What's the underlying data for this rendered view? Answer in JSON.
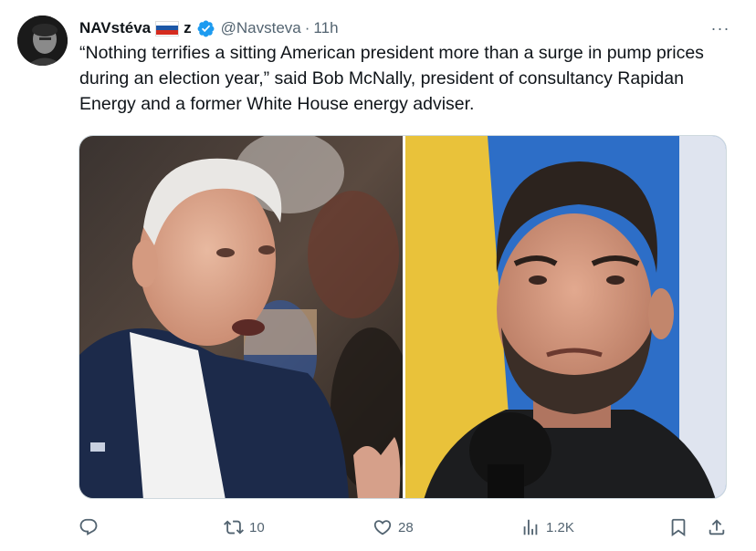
{
  "tweet": {
    "display_name_prefix": "NAVstéva",
    "display_name_suffix": "z",
    "handle": "@Navsteva",
    "separator": "·",
    "time": "11h",
    "more_label": "···",
    "text": "“Nothing terrifies a sitting American president more than a surge in pump prices during an election year,” said Bob McNally, president of consultancy Rapidan Energy and a former White House energy adviser."
  },
  "colors": {
    "verified": "#1d9bf0",
    "secondary_text": "#536471",
    "primary_text": "#0f1419"
  },
  "actions": {
    "reply": {
      "icon": "reply-icon",
      "count": ""
    },
    "retweet": {
      "icon": "retweet-icon",
      "count": "10"
    },
    "like": {
      "icon": "heart-icon",
      "count": "28"
    },
    "views": {
      "icon": "views-icon",
      "count": "1.2K"
    },
    "bookmark": {
      "icon": "bookmark-icon"
    },
    "share": {
      "icon": "share-icon"
    }
  }
}
